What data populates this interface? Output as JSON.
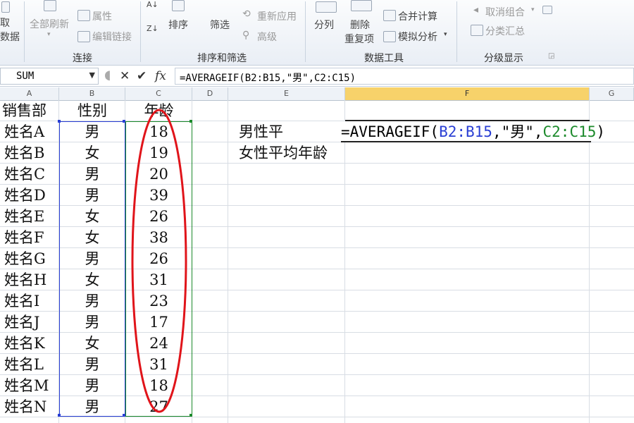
{
  "ribbon": {
    "connect_group": {
      "get_data_line1": "取",
      "get_data_line2": "数据",
      "refresh_all": "全部刷新",
      "properties": "属性",
      "edit_links": "编辑链接",
      "label": "连接"
    },
    "sort_group": {
      "sort": "排序",
      "filter": "筛选",
      "reapply": "重新应用",
      "advanced": "高级",
      "label": "排序和筛选"
    },
    "tools_group": {
      "text_to_columns": "分列",
      "remove_dup_line1": "删除",
      "remove_dup_line2": "重复项",
      "consolidate": "合并计算",
      "what_if": "模拟分析",
      "label": "数据工具"
    },
    "outline_group": {
      "ungroup": "取消组合",
      "subtotal": "分类汇总",
      "label": "分级显示"
    }
  },
  "formula_bar": {
    "name_box": "SUM",
    "formula": "=AVERAGEIF(B2:B15,\"男\",C2:C15)"
  },
  "columns": [
    "A",
    "B",
    "C",
    "D",
    "E",
    "F",
    "G"
  ],
  "selected_column": "F",
  "headers": {
    "a": "销售部",
    "b": "性别",
    "c": "年龄"
  },
  "rows": [
    {
      "name": "姓名A",
      "gender": "男",
      "age": "18"
    },
    {
      "name": "姓名B",
      "gender": "女",
      "age": "19"
    },
    {
      "name": "姓名C",
      "gender": "男",
      "age": "20"
    },
    {
      "name": "姓名D",
      "gender": "男",
      "age": "39"
    },
    {
      "name": "姓名E",
      "gender": "女",
      "age": "26"
    },
    {
      "name": "姓名F",
      "gender": "女",
      "age": "38"
    },
    {
      "name": "姓名G",
      "gender": "男",
      "age": "26"
    },
    {
      "name": "姓名H",
      "gender": "女",
      "age": "31"
    },
    {
      "name": "姓名I",
      "gender": "男",
      "age": "23"
    },
    {
      "name": "姓名J",
      "gender": "男",
      "age": "17"
    },
    {
      "name": "姓名K",
      "gender": "女",
      "age": "24"
    },
    {
      "name": "姓名L",
      "gender": "男",
      "age": "31"
    },
    {
      "name": "姓名M",
      "gender": "男",
      "age": "18"
    },
    {
      "name": "姓名N",
      "gender": "男",
      "age": "27"
    }
  ],
  "labels": {
    "male_avg": "男性平",
    "female_avg": "女性平均年龄"
  },
  "edit_cell": {
    "prefix": "=AVERAGEIF(",
    "range_b": "B2:B15",
    "mid": ",\"男\",",
    "range_c": "C2:C15",
    "suffix": ")"
  },
  "colors": {
    "ref_b": "#2a3fd4",
    "ref_c": "#1c8a2b",
    "annotation": "#e0141a",
    "selected_header": "#f7d26a"
  }
}
